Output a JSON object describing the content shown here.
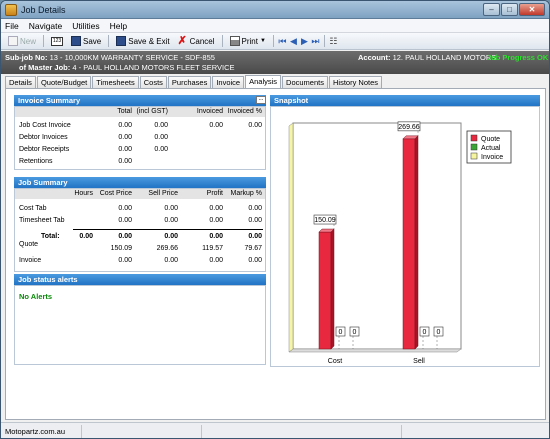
{
  "window": {
    "title": "Job Details"
  },
  "menu": [
    "File",
    "Navigate",
    "Utilities",
    "Help"
  ],
  "toolbar": {
    "new_label": "New",
    "save_label": "Save",
    "save_exit_label": "Save & Exit",
    "cancel_label": "Cancel",
    "print_label": "Print"
  },
  "job_header": {
    "subjob_label": "Sub-job No:",
    "subjob_value": "13 - 10,000KM WARRANTY SERVICE - SDF-855",
    "master_label": "of Master Job:",
    "master_value": "4 - PAUL HOLLAND MOTORS FLEET SERVICE",
    "account_label": "Account:",
    "account_value": "12. PAUL HOLLAND MOTORS",
    "status": "Job Progress OK"
  },
  "tabs": [
    "Details",
    "Quote/Budget",
    "Timesheets",
    "Costs",
    "Purchases",
    "Invoice",
    "Analysis",
    "Documents",
    "History Notes"
  ],
  "active_tab": "Analysis",
  "invoice_summary": {
    "title": "Invoice Summary",
    "columns": [
      "Total",
      "(incl GST)",
      "Invoiced",
      "Invoiced %"
    ],
    "rows": [
      {
        "label": "Job Cost Invoice",
        "values": [
          "0.00",
          "0.00",
          "0.00",
          "0.00"
        ]
      },
      {
        "label": "Debtor Invoices",
        "values": [
          "0.00",
          "0.00",
          "",
          ""
        ]
      },
      {
        "label": "Debtor Receipts",
        "values": [
          "0.00",
          "0.00",
          "",
          ""
        ]
      },
      {
        "label": "Retentions",
        "values": [
          "0.00",
          "",
          "",
          ""
        ]
      }
    ]
  },
  "job_summary": {
    "title": "Job Summary",
    "columns": [
      "Hours",
      "Cost Price",
      "Sell Price",
      "Profit",
      "Markup %"
    ],
    "rows": [
      {
        "label": "Cost Tab",
        "values": [
          "",
          "0.00",
          "0.00",
          "0.00",
          "0.00"
        ]
      },
      {
        "label": "Timesheet Tab",
        "values": [
          "",
          "0.00",
          "0.00",
          "0.00",
          "0.00"
        ]
      }
    ],
    "total": {
      "label": "Total:",
      "values": [
        "0.00",
        "0.00",
        "0.00",
        "0.00",
        "0.00"
      ]
    },
    "quote": {
      "label": "Quote",
      "values": [
        "",
        "150.09",
        "269.66",
        "119.57",
        "79.67"
      ]
    },
    "invoice": {
      "label": "Invoice",
      "values": [
        "",
        "0.00",
        "0.00",
        "0.00",
        "0.00"
      ]
    }
  },
  "alerts": {
    "title": "Job status alerts",
    "text": "No Alerts"
  },
  "snapshot": {
    "title": "Snapshot"
  },
  "chart_data": {
    "type": "bar",
    "categories": [
      "Cost",
      "Sell"
    ],
    "series": [
      {
        "name": "Quote",
        "values": [
          150.09,
          269.66
        ],
        "color": "#e8283e"
      },
      {
        "name": "Actual",
        "values": [
          0,
          0
        ],
        "color": "#3aa534"
      },
      {
        "name": "Invoice",
        "values": [
          0,
          0
        ],
        "color": "#f5f5a0"
      }
    ],
    "data_labels": [
      [
        "150.09",
        "0",
        "0"
      ],
      [
        "269.66",
        "0",
        "0"
      ]
    ],
    "legend_position": "top-right",
    "grid": false
  },
  "statusbar": {
    "text": "Motopartz.com.au"
  }
}
